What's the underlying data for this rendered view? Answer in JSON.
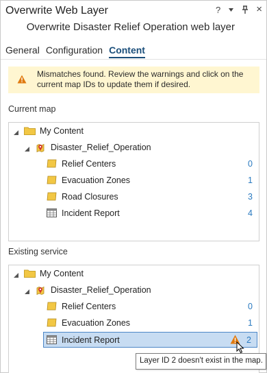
{
  "window": {
    "title": "Overwrite Web Layer",
    "help": "?",
    "menu": "▾",
    "pin": "📌",
    "close": "×"
  },
  "subtitle": "Overwrite Disaster Relief Operation web layer",
  "tabs": [
    {
      "label": "General",
      "active": false
    },
    {
      "label": "Configuration",
      "active": false
    },
    {
      "label": "Content",
      "active": true
    }
  ],
  "banner": {
    "text": "Mismatches found. Review the warnings and click on the current map IDs to update them if desired."
  },
  "current_map": {
    "label": "Current map",
    "root": "My Content",
    "map": "Disaster_Relief_Operation",
    "items": [
      {
        "label": "Relief Centers",
        "id": "0",
        "type": "feature-layer"
      },
      {
        "label": "Evacuation Zones",
        "id": "1",
        "type": "feature-layer"
      },
      {
        "label": "Road Closures",
        "id": "3",
        "type": "feature-layer"
      },
      {
        "label": "Incident Report",
        "id": "4",
        "type": "table"
      }
    ]
  },
  "existing_service": {
    "label": "Existing service",
    "root": "My Content",
    "map": "Disaster_Relief_Operation",
    "items": [
      {
        "label": "Relief Centers",
        "id": "0",
        "type": "feature-layer"
      },
      {
        "label": "Evacuation Zones",
        "id": "1",
        "type": "feature-layer"
      },
      {
        "label": "Incident Report",
        "id": "2",
        "type": "table",
        "selected": true,
        "warning": true
      }
    ]
  },
  "tooltip": "Layer ID 2 doesn't exist in the map.",
  "colors": {
    "accent": "#1a4e7a",
    "link": "#2a7ac0",
    "banner_bg": "#fff6d1",
    "warning": "#e07a10",
    "folder": "#f2c744",
    "selected_bg": "#c7dcf2"
  }
}
